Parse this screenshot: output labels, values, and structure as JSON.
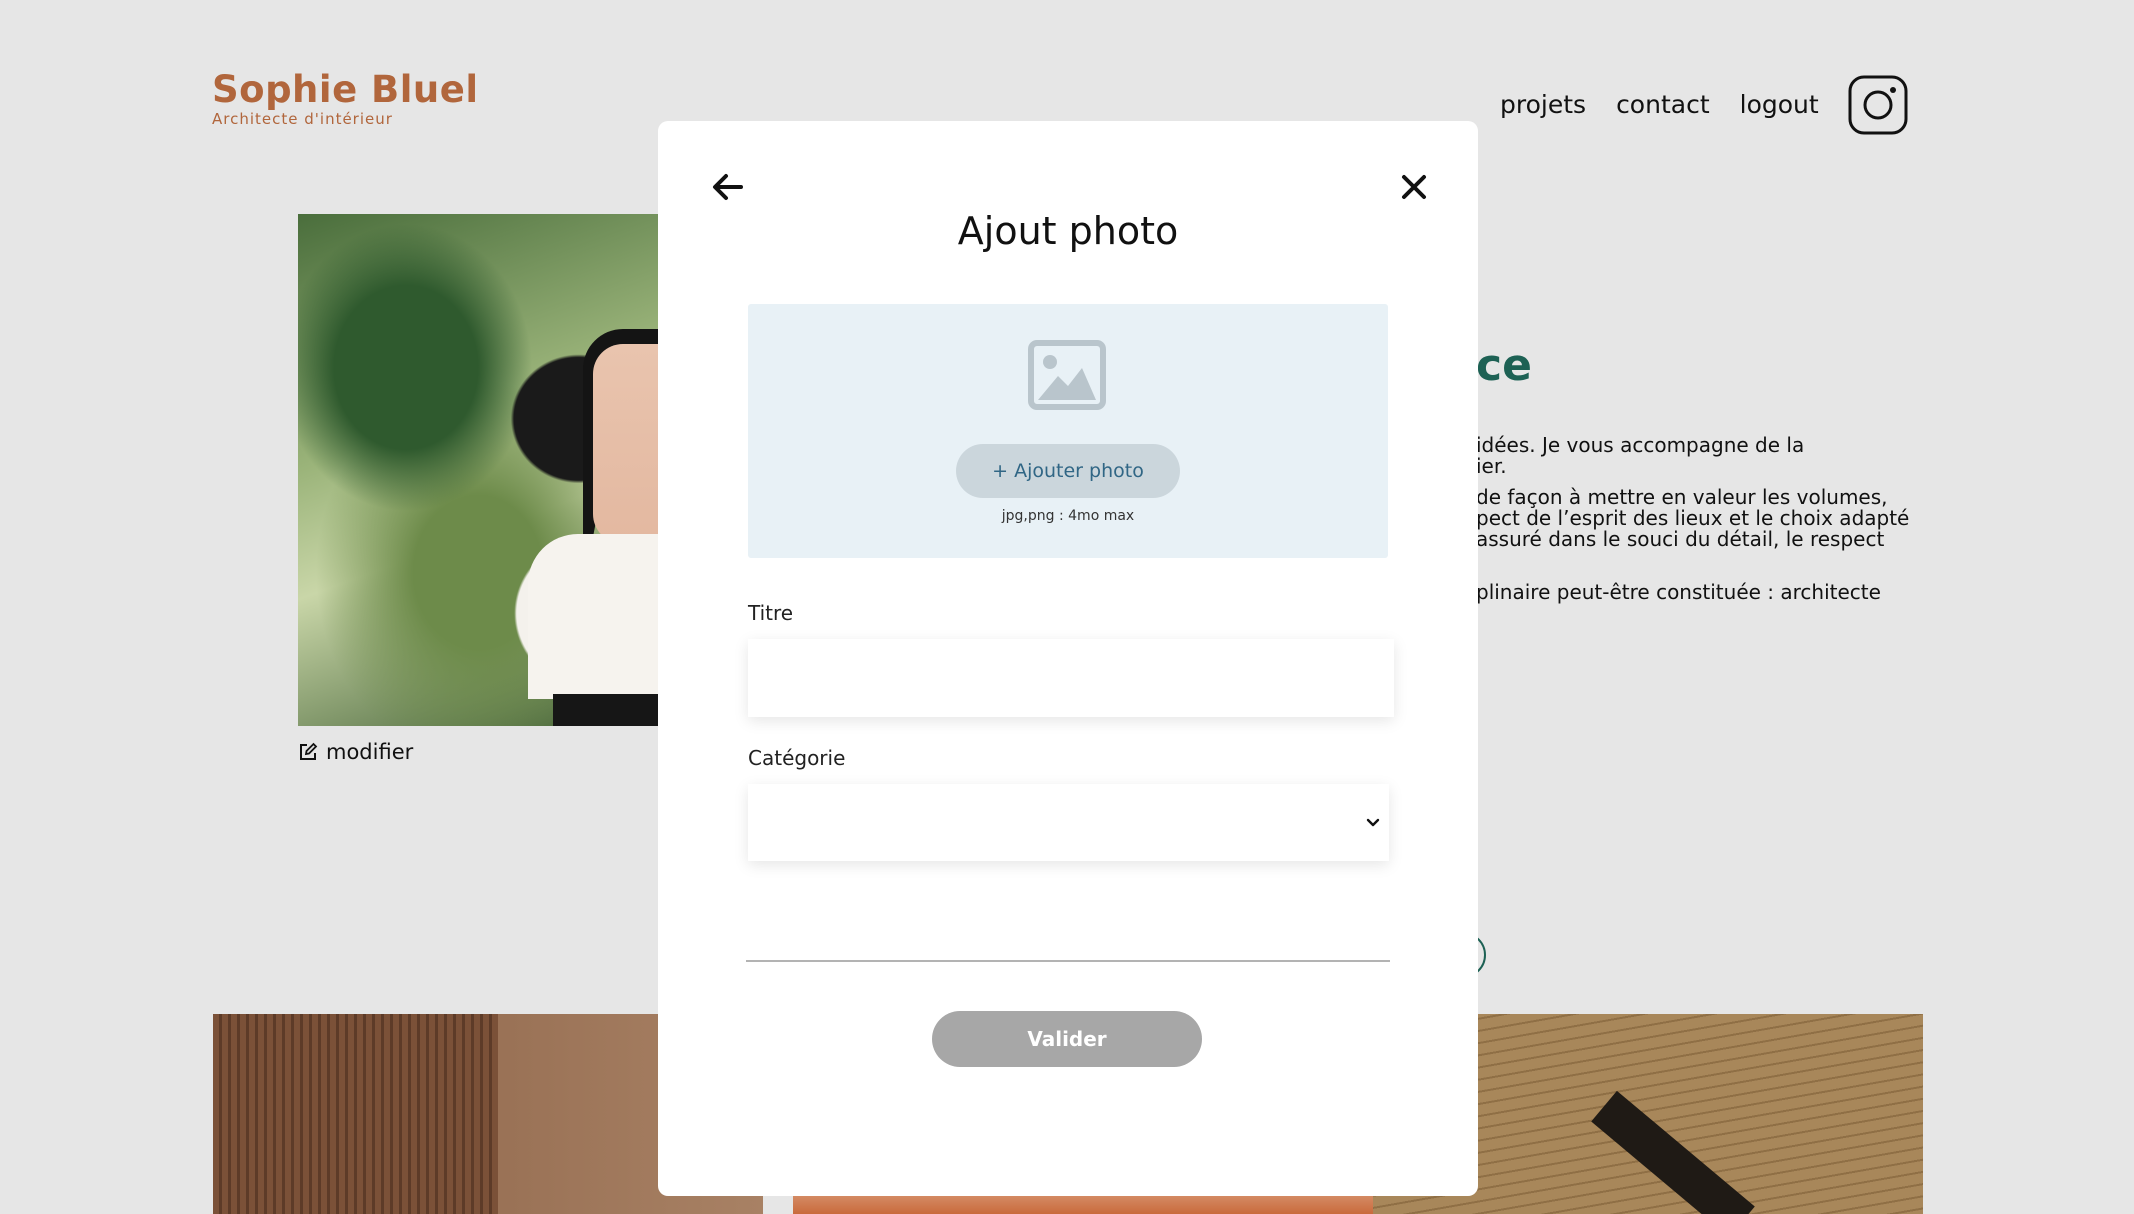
{
  "header": {
    "logo_title": "Sophie Bluel",
    "logo_subtitle": "Architecte d'intérieur",
    "nav": [
      "projets",
      "contact",
      "logout"
    ]
  },
  "background": {
    "edit_label": "modifier",
    "heading_fragment": "ce",
    "text_lines": [
      "idées. Je vous accompagne de la\nier.",
      "de façon à mettre en valeur les volumes,\npect de l’esprit des lieux et le choix adapté\n assuré dans le souci du détail, le respect",
      "plinaire peut-être constituée : architecte"
    ]
  },
  "modal": {
    "title": "Ajout photo",
    "add_photo_label": "+ Ajouter photo",
    "file_hint": "jpg,png : 4mo max",
    "title_label": "Titre",
    "title_value": "",
    "category_label": "Catégorie",
    "category_value": "",
    "submit_label": "Valider"
  },
  "colors": {
    "brand": "#b1663c",
    "accent_green": "#1d6154",
    "dropzone_bg": "#e8f1f6",
    "add_photo_text": "#306685",
    "submit_disabled": "#a7a7a7"
  },
  "icons": {
    "back": "arrow-left-icon",
    "close": "close-icon",
    "dropzone": "image-icon",
    "select": "chevron-down-icon",
    "social": "instagram-icon",
    "edit": "edit-icon"
  }
}
